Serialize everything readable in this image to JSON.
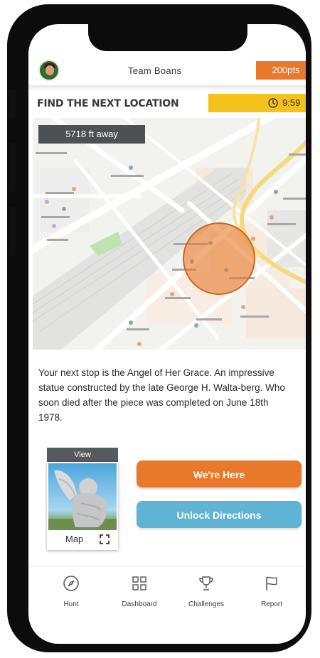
{
  "header": {
    "team_name": "Team Boans",
    "points": "200pts"
  },
  "title_row": {
    "title": "FIND THE NEXT LOCATION",
    "timer": "9:59"
  },
  "map": {
    "distance": "5718 ft away",
    "target_color": "#e8792b"
  },
  "description": "Your next stop is the Angel of Her Grace. An impressive statue constructed by the late George H. Walta-berg. Who soon died after the piece was completed on June 18th 1978.",
  "card": {
    "header": "View",
    "map_label": "Map"
  },
  "buttons": {
    "here": "We're Here",
    "unlock": "Unlock Directions"
  },
  "nav": {
    "items": [
      {
        "label": "Hunt",
        "icon": "compass-icon"
      },
      {
        "label": "Dashboard",
        "icon": "grid-icon"
      },
      {
        "label": "Challenges",
        "icon": "trophy-icon"
      },
      {
        "label": "Report",
        "icon": "flag-icon"
      }
    ]
  },
  "colors": {
    "accent_orange": "#e8792b",
    "timer_yellow": "#f4c21a",
    "unlock_blue": "#5fb3d4",
    "dark_badge": "#4c5156"
  }
}
